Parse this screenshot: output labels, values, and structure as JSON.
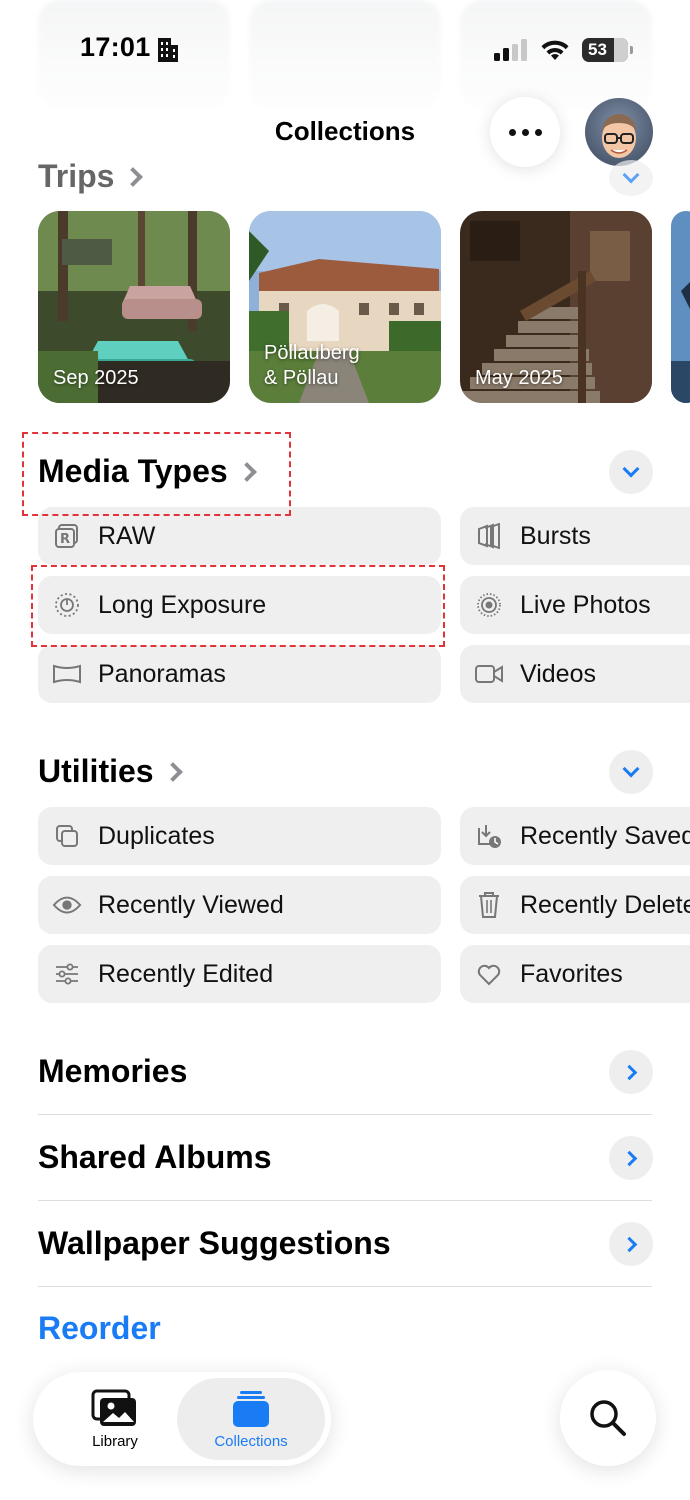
{
  "status_bar": {
    "time": "17:01",
    "battery": "53"
  },
  "header": {
    "title": "Collections"
  },
  "sections": {
    "trips": {
      "title": "Trips",
      "cards": [
        {
          "label": "Sep 2025"
        },
        {
          "label_line1": "Pöllauberg",
          "label_line2": "& Pöllau"
        },
        {
          "label": "May 2025"
        }
      ]
    },
    "media_types": {
      "title": "Media Types",
      "items": [
        {
          "label": "RAW",
          "icon": "raw-icon"
        },
        {
          "label": "Bursts",
          "icon": "bursts-icon"
        },
        {
          "label": "Long Exposure",
          "icon": "long-exposure-icon"
        },
        {
          "label": "Live Photos",
          "icon": "live-photos-icon"
        },
        {
          "label": "Panoramas",
          "icon": "panorama-icon"
        },
        {
          "label": "Videos",
          "icon": "video-icon"
        }
      ]
    },
    "utilities": {
      "title": "Utilities",
      "items": [
        {
          "label": "Duplicates",
          "icon": "duplicates-icon"
        },
        {
          "label": "Recently Saved",
          "icon": "recently-saved-icon"
        },
        {
          "label": "Recently Viewed",
          "icon": "eye-icon"
        },
        {
          "label": "Recently Deleted",
          "icon": "trash-icon"
        },
        {
          "label": "Recently Edited",
          "icon": "sliders-icon"
        },
        {
          "label": "Favorites",
          "icon": "heart-icon"
        }
      ]
    },
    "rows": [
      {
        "title": "Memories"
      },
      {
        "title": "Shared Albums"
      },
      {
        "title": "Wallpaper Suggestions"
      }
    ],
    "reorder": "Reorder"
  },
  "tabbar": {
    "library": "Library",
    "collections": "Collections"
  },
  "colors": {
    "accent": "#1a7cf5",
    "highlight": "#e0343a",
    "pill_bg": "#efeff0"
  }
}
